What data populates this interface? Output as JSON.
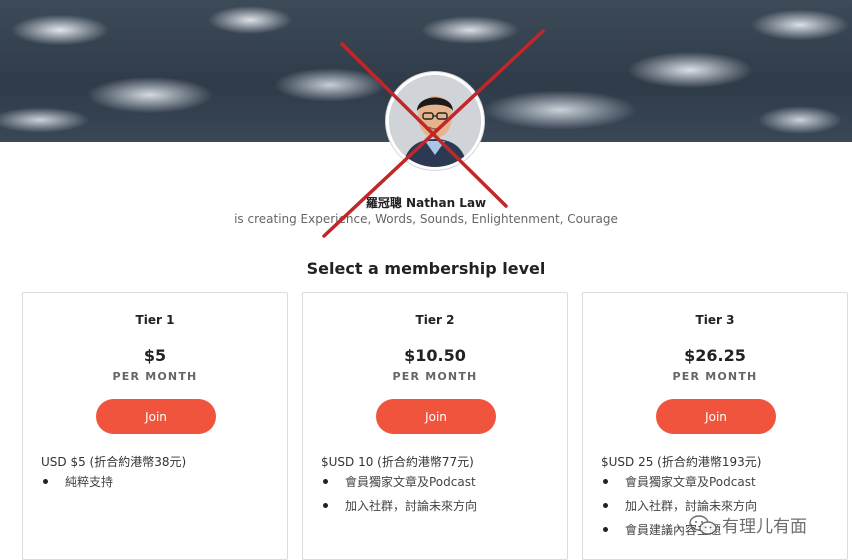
{
  "creator": {
    "name": "羅冠聰 Nathan Law",
    "tagline": "is creating Experience, Words, Sounds, Enlightenment, Courage"
  },
  "section_title": "Select a membership level",
  "tiers": [
    {
      "name": "Tier 1",
      "price": "$5",
      "period": "PER MONTH",
      "join_label": "Join",
      "description": "USD $5   (折合約港幣38元)",
      "benefits": [
        "純粹支持"
      ]
    },
    {
      "name": "Tier 2",
      "price": "$10.50",
      "period": "PER MONTH",
      "join_label": "Join",
      "description": "$USD 10  (折合約港幣77元)",
      "benefits": [
        "會員獨家文章及Podcast",
        "加入社群，討論未來方向"
      ]
    },
    {
      "name": "Tier 3",
      "price": "$26.25",
      "period": "PER MONTH",
      "join_label": "Join",
      "description": "$USD 25  (折合約港幣193元)",
      "benefits": [
        "會員獨家文章及Podcast",
        "加入社群，討論未來方向",
        "會員建議內容主題"
      ]
    }
  ],
  "watermark": {
    "text": "有理儿有面",
    "icon": "wechat-icon"
  },
  "colors": {
    "accent": "#f0543c",
    "cross": "#c0262a"
  }
}
